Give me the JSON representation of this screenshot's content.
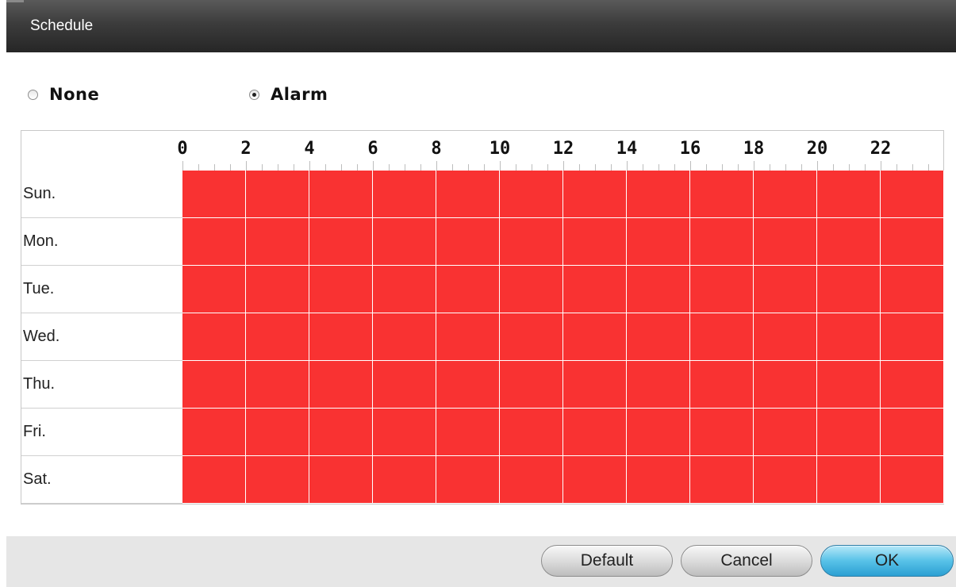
{
  "window": {
    "title": "Schedule"
  },
  "mode": {
    "options": [
      {
        "label": "None",
        "selected": false
      },
      {
        "label": "Alarm",
        "selected": true
      }
    ]
  },
  "grid": {
    "hour_labels": [
      "0",
      "2",
      "4",
      "6",
      "8",
      "10",
      "12",
      "14",
      "16",
      "18",
      "20",
      "22"
    ],
    "days": [
      "Sun.",
      "Mon.",
      "Tue.",
      "Wed.",
      "Thu.",
      "Fri.",
      "Sat."
    ],
    "active_color": "#f93232",
    "all_active": true
  },
  "buttons": {
    "default_label": "Default",
    "cancel_label": "Cancel",
    "ok_label": "OK"
  },
  "colors": {
    "titlebar": "#3c3c3c",
    "footer": "#e6e6e6",
    "ok_button": "#58c2e8"
  }
}
